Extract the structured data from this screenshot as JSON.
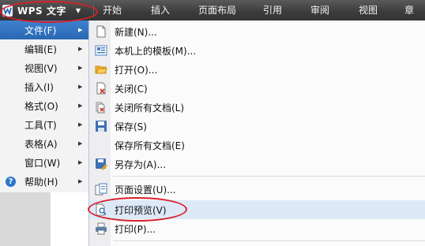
{
  "app": {
    "name": "WPS 文字",
    "caret": "▼"
  },
  "tabs": [
    {
      "label": "开始"
    },
    {
      "label": "插入"
    },
    {
      "label": "页面布局"
    },
    {
      "label": "引用"
    },
    {
      "label": "审阅"
    },
    {
      "label": "视图"
    },
    {
      "label": "章节"
    }
  ],
  "main_menu": {
    "items": [
      {
        "label": "文件(F)",
        "selected": true
      },
      {
        "label": "编辑(E)"
      },
      {
        "label": "视图(V)"
      },
      {
        "label": "插入(I)"
      },
      {
        "label": "格式(O)"
      },
      {
        "label": "工具(T)"
      },
      {
        "label": "表格(A)"
      },
      {
        "label": "窗口(W)"
      },
      {
        "label": "帮助(H)",
        "icon": "help-icon"
      }
    ],
    "arrow": "▶",
    "help_glyph": "?"
  },
  "file_menu": {
    "items": [
      {
        "label": "新建(N)...",
        "icon": "new-document-icon"
      },
      {
        "label": "本机上的模板(M)...",
        "icon": "template-icon"
      },
      {
        "label": "打开(O)...",
        "icon": "open-folder-icon"
      },
      {
        "label": "关闭(C)",
        "icon": "close-document-icon"
      },
      {
        "label": "关闭所有文档(L)",
        "icon": "close-all-icon"
      },
      {
        "label": "保存(S)",
        "icon": "save-icon"
      },
      {
        "label": "保存所有文档(E)",
        "icon": ""
      },
      {
        "label": "另存为(A)...",
        "icon": "save-as-icon"
      },
      {
        "label": "页面设置(U)...",
        "icon": "page-setup-icon"
      },
      {
        "label": "打印预览(V)",
        "icon": "print-preview-icon",
        "highlighted": true
      },
      {
        "label": "打印(P)...",
        "icon": "printer-icon"
      }
    ]
  },
  "colors": {
    "annotation": "#d8202a",
    "selection": "#2e6fbf",
    "toolbar": "#3f3f3f"
  }
}
